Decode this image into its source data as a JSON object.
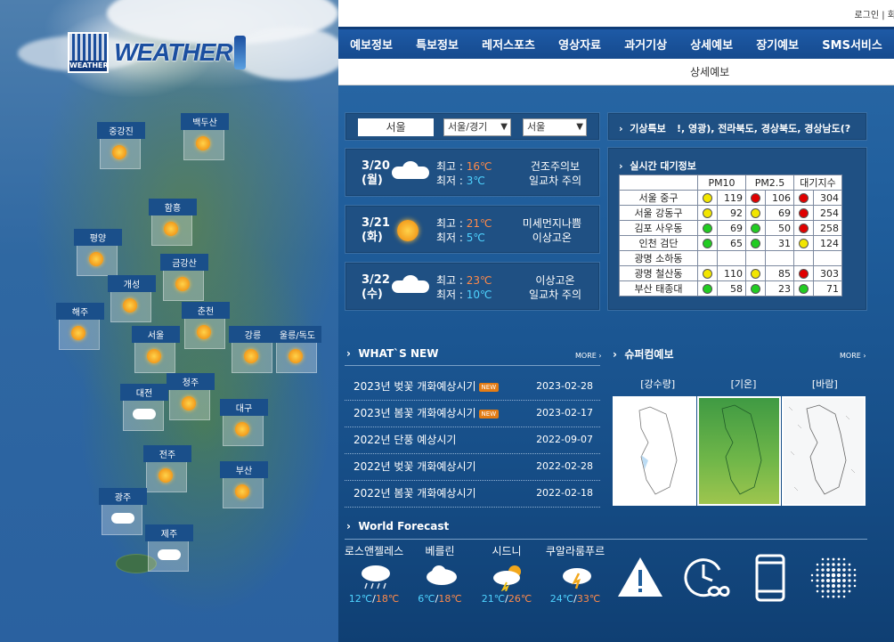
{
  "login_text": "로그인 | 회",
  "nav": [
    "예보정보",
    "특보정보",
    "레저스포츠",
    "영상자료",
    "과거기상",
    "상세예보",
    "장기예보",
    "SMS서비스"
  ],
  "subnav": "상세예보",
  "logo": {
    "word": "WEATHER",
    "badge": "WEATHER"
  },
  "cities": [
    {
      "name": "중강진",
      "icon": "sun"
    },
    {
      "name": "백두산",
      "icon": "sun"
    },
    {
      "name": "함흥",
      "icon": "sun"
    },
    {
      "name": "평양",
      "icon": "sun"
    },
    {
      "name": "금강산",
      "icon": "sun"
    },
    {
      "name": "개성",
      "icon": "sun"
    },
    {
      "name": "해주",
      "icon": "sun"
    },
    {
      "name": "춘천",
      "icon": "sun"
    },
    {
      "name": "서울",
      "icon": "sun"
    },
    {
      "name": "강릉",
      "icon": "sun"
    },
    {
      "name": "울릉/독도",
      "icon": "sun"
    },
    {
      "name": "청주",
      "icon": "sun"
    },
    {
      "name": "대전",
      "icon": "cloud"
    },
    {
      "name": "대구",
      "icon": "sun"
    },
    {
      "name": "전주",
      "icon": "sun"
    },
    {
      "name": "부산",
      "icon": "sun"
    },
    {
      "name": "광주",
      "icon": "cloud"
    },
    {
      "name": "제주",
      "icon": "cloud"
    }
  ],
  "location": {
    "current": "서울",
    "region": "서울/경기",
    "city": "서울"
  },
  "days": [
    {
      "date": "3/20",
      "dow": "(월)",
      "icon": "cloud",
      "hi_label": "최고 : ",
      "hi": "16℃",
      "lo_label": "최저 : ",
      "lo": "3℃",
      "note1": "건조주의보",
      "note2": "일교차 주의"
    },
    {
      "date": "3/21",
      "dow": "(화)",
      "icon": "sun",
      "hi_label": "최고 : ",
      "hi": "21℃",
      "lo_label": "최저 : ",
      "lo": "5℃",
      "note1": "미세먼지나쁨",
      "note2": "이상고온"
    },
    {
      "date": "3/22",
      "dow": "(수)",
      "icon": "cloud",
      "hi_label": "최고 : ",
      "hi": "23℃",
      "lo_label": "최저 : ",
      "lo": "10℃",
      "note1": "이상고온",
      "note2": "일교차 주의"
    }
  ],
  "alert": {
    "label": "기상특보",
    "text": "!, 영광), 전라북도, 경상북도, 경상남도(?"
  },
  "air": {
    "label": "실시간 대기정보",
    "headers": [
      "",
      "PM10",
      "PM2.5",
      "대기지수"
    ],
    "rows": [
      {
        "place": "서울 중구",
        "pm10_color": "#f2e600",
        "pm10": "119",
        "pm25_color": "#e00000",
        "pm25": "106",
        "idx_color": "#e00000",
        "idx": "304"
      },
      {
        "place": "서울 강동구",
        "pm10_color": "#f2e600",
        "pm10": "92",
        "pm25_color": "#f2e600",
        "pm25": "69",
        "idx_color": "#e00000",
        "idx": "254"
      },
      {
        "place": "김포 사우동",
        "pm10_color": "#22cc22",
        "pm10": "69",
        "pm25_color": "#22cc22",
        "pm25": "50",
        "idx_color": "#e00000",
        "idx": "258"
      },
      {
        "place": "인천 검단",
        "pm10_color": "#22cc22",
        "pm10": "65",
        "pm25_color": "#22cc22",
        "pm25": "31",
        "idx_color": "#f2e600",
        "idx": "124"
      },
      {
        "place": "광명 소하동",
        "pm10_color": "",
        "pm10": "",
        "pm25_color": "",
        "pm25": "",
        "idx_color": "",
        "idx": ""
      },
      {
        "place": "광명 철산동",
        "pm10_color": "#f2e600",
        "pm10": "110",
        "pm25_color": "#f2e600",
        "pm25": "85",
        "idx_color": "#e00000",
        "idx": "303"
      },
      {
        "place": "부산 태종대",
        "pm10_color": "#22cc22",
        "pm10": "58",
        "pm25_color": "#22cc22",
        "pm25": "23",
        "idx_color": "#22cc22",
        "idx": "71"
      }
    ]
  },
  "whats_new": {
    "title": "WHAT`S NEW",
    "more": "MORE",
    "new_badge": "NEW",
    "items": [
      {
        "title": "2023년 벚꽃 개화예상시기",
        "new": true,
        "date": "2023-02-28"
      },
      {
        "title": "2023년 봄꽃 개화예상시기",
        "new": true,
        "date": "2023-02-17"
      },
      {
        "title": "2022년 단풍 예상시기",
        "new": false,
        "date": "2022-09-07"
      },
      {
        "title": "2022년 벚꽃 개화예상시기",
        "new": false,
        "date": "2022-02-28"
      },
      {
        "title": "2022년 봄꽃 개화예상시기",
        "new": false,
        "date": "2022-02-18"
      }
    ]
  },
  "supercom": {
    "title": "슈퍼컴예보",
    "more": "MORE",
    "tabs": [
      "[강수량]",
      "[기온]",
      "[바람]"
    ]
  },
  "world": {
    "title": "World Forecast",
    "cities": [
      {
        "name": "로스앤젤레스",
        "icon": "rain",
        "lo": "12℃",
        "hi": "18℃"
      },
      {
        "name": "베를린",
        "icon": "cloud",
        "lo": "6℃",
        "hi": "18℃"
      },
      {
        "name": "시드니",
        "icon": "storm",
        "lo": "21℃",
        "hi": "26℃"
      },
      {
        "name": "쿠알라룸푸르",
        "icon": "thunder",
        "lo": "24℃",
        "hi": "33℃"
      }
    ],
    "sep": "/"
  },
  "icons": [
    "warning-icon",
    "clock-infinity-icon",
    "smartphone-icon",
    "dot-sphere-icon"
  ]
}
